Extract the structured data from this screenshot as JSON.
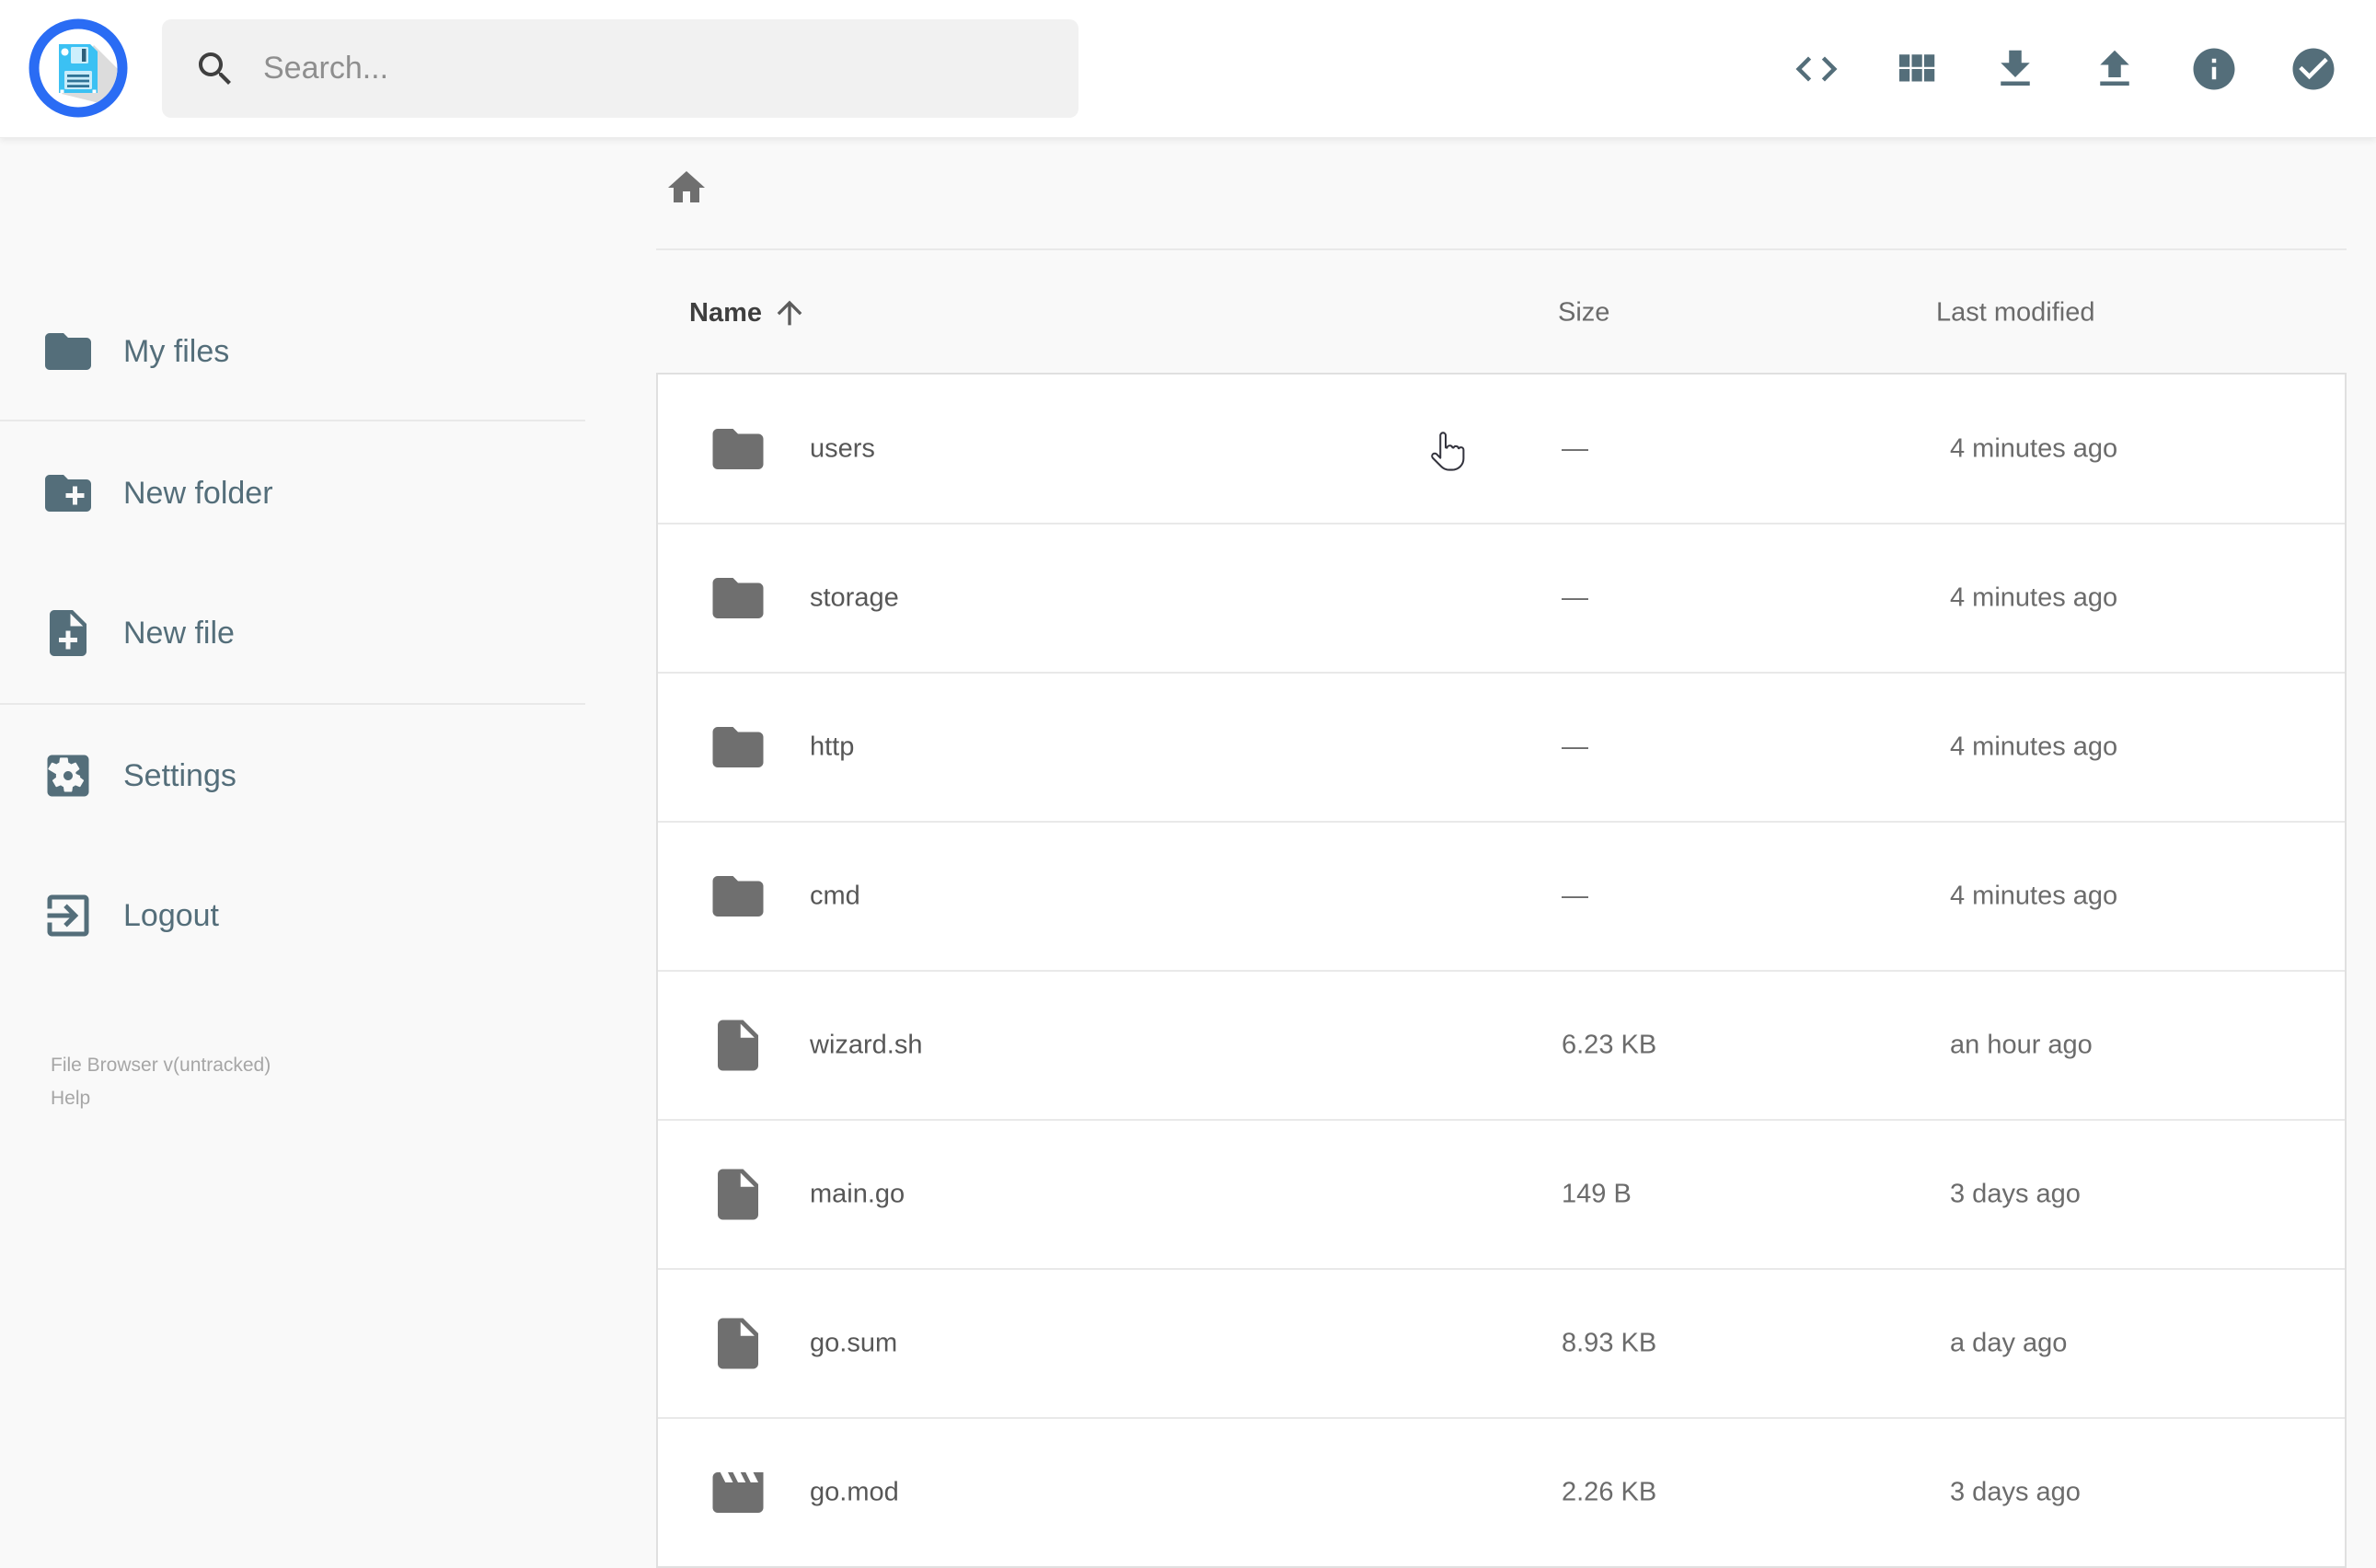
{
  "app": {
    "name": "File Browser"
  },
  "colors": {
    "accent_blue": "#2a6cf4",
    "logo_cyan": "#3bc1f3",
    "slate": "#546e7a",
    "icon_gray": "#6f6f6f",
    "page_bg": "#f9f9f9",
    "search_bg": "#f1f1f1",
    "row_border": "#e9e9e9"
  },
  "header": {
    "logo_icon": "floppy-disk-logo",
    "search": {
      "placeholder": "Search...",
      "value": "",
      "icon": "search-icon"
    },
    "actions": [
      {
        "icon": "code-icon"
      },
      {
        "icon": "grid-view-icon"
      },
      {
        "icon": "download-icon"
      },
      {
        "icon": "upload-icon"
      },
      {
        "icon": "info-icon"
      },
      {
        "icon": "check-circle-icon"
      }
    ]
  },
  "sidebar": {
    "items": [
      {
        "label": "My files",
        "icon": "folder-icon"
      },
      {
        "label": "New folder",
        "icon": "new-folder-icon"
      },
      {
        "label": "New file",
        "icon": "new-file-icon"
      },
      {
        "label": "Settings",
        "icon": "settings-icon"
      },
      {
        "label": "Logout",
        "icon": "logout-icon"
      }
    ],
    "footer": {
      "version": "File Browser v(untracked)",
      "help": "Help"
    }
  },
  "main": {
    "breadcrumb": {
      "home_icon": "home-icon"
    },
    "table": {
      "columns": [
        "Name",
        "Size",
        "Last modified"
      ],
      "sort": {
        "column": "Name",
        "direction": "ascending",
        "icon": "arrow-up-icon"
      },
      "rows": [
        {
          "name": "users",
          "type": "folder",
          "icon": "folder-icon",
          "size": "—",
          "modified": "4 minutes ago"
        },
        {
          "name": "storage",
          "type": "folder",
          "icon": "folder-icon",
          "size": "—",
          "modified": "4 minutes ago"
        },
        {
          "name": "http",
          "type": "folder",
          "icon": "folder-icon",
          "size": "—",
          "modified": "4 minutes ago"
        },
        {
          "name": "cmd",
          "type": "folder",
          "icon": "folder-icon",
          "size": "—",
          "modified": "4 minutes ago"
        },
        {
          "name": "wizard.sh",
          "type": "file",
          "icon": "file-icon",
          "size": "6.23 KB",
          "modified": "an hour ago"
        },
        {
          "name": "main.go",
          "type": "file",
          "icon": "file-icon",
          "size": "149 B",
          "modified": "3 days ago"
        },
        {
          "name": "go.sum",
          "type": "file",
          "icon": "file-icon",
          "size": "8.93 KB",
          "modified": "a day ago"
        },
        {
          "name": "go.mod",
          "type": "file",
          "icon": "movie-icon",
          "size": "2.26 KB",
          "modified": "3 days ago"
        }
      ]
    }
  }
}
